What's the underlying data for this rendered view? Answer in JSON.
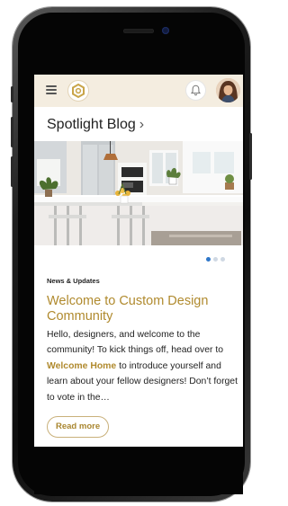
{
  "blog": {
    "section_title": "Spotlight Blog",
    "chevron": "›"
  },
  "post": {
    "category": "News & Updates",
    "title": "Welcome to Custom Design Community",
    "body_part1": "Hello, designers, and welcome to the community! To kick things off, head over to ",
    "link_text": "Welcome Home",
    "body_part2": " to introduce yourself and learn about your fellow designers! Don’t forget to vote in the…",
    "read_more": "Read more"
  },
  "carousel": {
    "total_slides": 3,
    "active_slide": 1
  },
  "icons": {
    "menu": "hamburger-menu-icon",
    "logo": "hexagon-logo-icon",
    "notifications": "bell-icon",
    "avatar": "user-avatar"
  },
  "colors": {
    "header_bg": "#f4ede0",
    "accent_gold": "#b08a2e",
    "carousel_active": "#2f77c9"
  }
}
